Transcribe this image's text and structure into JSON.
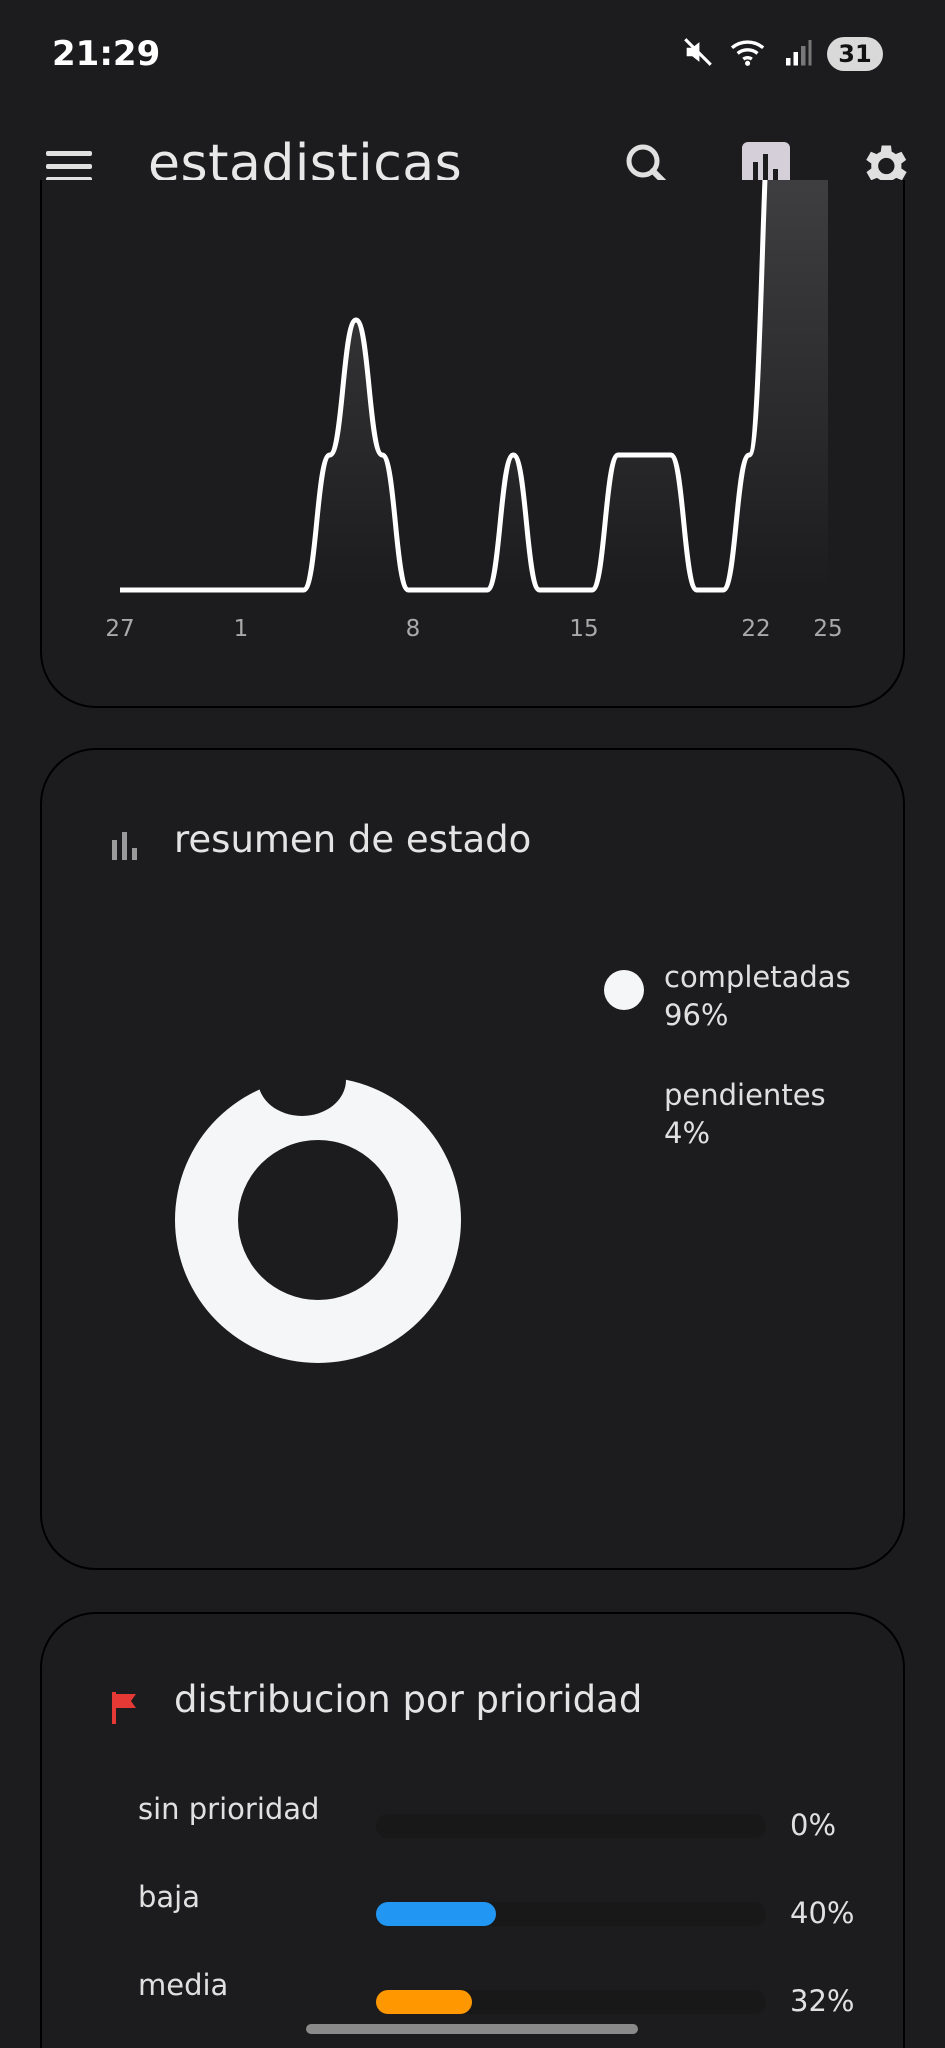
{
  "status_bar": {
    "time": "21:29",
    "battery": "31"
  },
  "app_bar": {
    "title": "estadisticas"
  },
  "timeline": {
    "x_ticks": [
      "27",
      "1",
      "8",
      "15",
      "22",
      "25"
    ]
  },
  "status_summary": {
    "title": "resumen de estado",
    "items": [
      {
        "label": "completadas",
        "value": "96%",
        "color": "#f5f6f8"
      },
      {
        "label": "pendientes",
        "value": "4%",
        "color": "#1c1c1e"
      }
    ]
  },
  "priority_distribution": {
    "title": "distribucion por prioridad",
    "rows": [
      {
        "label": "sin prioridad",
        "pct": "0%",
        "fraction": 0.0,
        "color": "#2196f3"
      },
      {
        "label": "baja",
        "pct": "40%",
        "fraction": 0.4,
        "color": "#2196f3"
      },
      {
        "label": "media",
        "pct": "32%",
        "fraction": 0.32,
        "color": "#ff9800"
      }
    ]
  },
  "chart_data": [
    {
      "type": "area",
      "x_tick_labels": [
        "27",
        "1",
        "8",
        "15",
        "22",
        "25"
      ],
      "series": [
        {
          "values": [
            0,
            0,
            0,
            0,
            0,
            0,
            0,
            0,
            1,
            2,
            1,
            0,
            0,
            0,
            0,
            1,
            0,
            0,
            0,
            1,
            1,
            1,
            0,
            0,
            1,
            4,
            5,
            6
          ]
        }
      ]
    },
    {
      "type": "pie",
      "labels": [
        "completadas",
        "pendientes"
      ],
      "values": [
        96,
        4
      ]
    },
    {
      "type": "bar",
      "categories": [
        "sin prioridad",
        "baja",
        "media"
      ],
      "values": [
        0,
        40,
        32
      ]
    }
  ]
}
